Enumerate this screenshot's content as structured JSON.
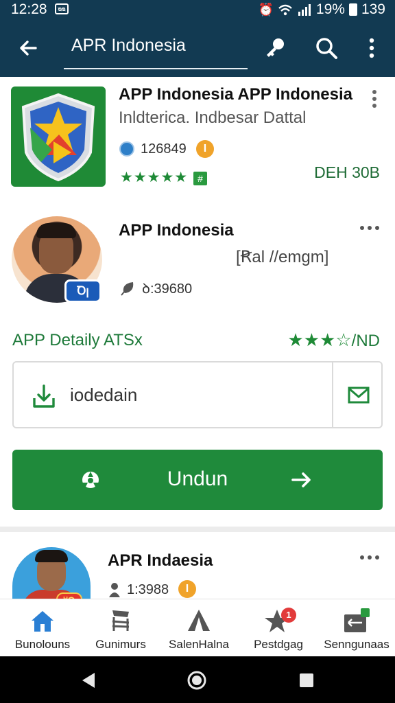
{
  "status_bar": {
    "time": "12:28",
    "notification": "ᴓᴓ",
    "battery": "19%",
    "extra": "139"
  },
  "app_bar": {
    "title": "APR Indonesia"
  },
  "app_listing": {
    "name": "APP Indonesia APP Indonesia",
    "developer": "Inldterica. Indbesar Dattal",
    "count": "126849",
    "coin": "I",
    "stars": "★★★★★",
    "size": "DEH 30B"
  },
  "profile": {
    "name": "APP Indonesia",
    "tag": "[Ꞧal //emgm]",
    "avatar_badge": "Ꝺꞁ",
    "count": "ꝺ:39680"
  },
  "detail": {
    "label": "APP Detaily ATSx",
    "rating_filled": "★★★",
    "rating_empty": "☆",
    "rating_suffix": "/ND"
  },
  "download_field": {
    "value": "iodedain"
  },
  "primary_button": {
    "label": "Undun"
  },
  "second_card": {
    "name": "APR Indaesia",
    "count": "1:3988",
    "coin": "I",
    "tag": "ᴴQ"
  },
  "bottom_nav": {
    "items": [
      {
        "label": "Bunolouns"
      },
      {
        "label": "Gunimurs"
      },
      {
        "label": "SalenHalna"
      },
      {
        "label": "Pestdgag",
        "badge": "1"
      },
      {
        "label": "Senngunaas"
      }
    ]
  },
  "colors": {
    "header": "#123a52",
    "accent_green": "#1f8a3b",
    "home_blue": "#2a7fd4"
  }
}
